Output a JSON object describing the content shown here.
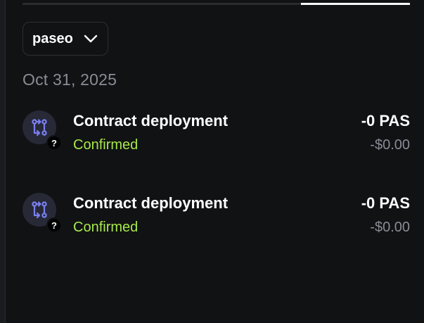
{
  "network_selector": {
    "value": "paseo",
    "icon": "chevron-down-icon"
  },
  "group": {
    "date": "Oct 31, 2025",
    "transactions": [
      {
        "title": "Contract deployment",
        "status": "Confirmed",
        "amount": "-0 PAS",
        "fiat": "-$0.00",
        "icon": "contract-icon",
        "badge": "?"
      },
      {
        "title": "Contract deployment",
        "status": "Confirmed",
        "amount": "-0 PAS",
        "fiat": "-$0.00",
        "icon": "contract-icon",
        "badge": "?"
      }
    ]
  },
  "colors": {
    "background": "#111214",
    "status_confirmed": "#a6e84a",
    "muted_text": "#8a8c96",
    "icon_accent": "#7b7ff0",
    "icon_bg": "#272937"
  }
}
